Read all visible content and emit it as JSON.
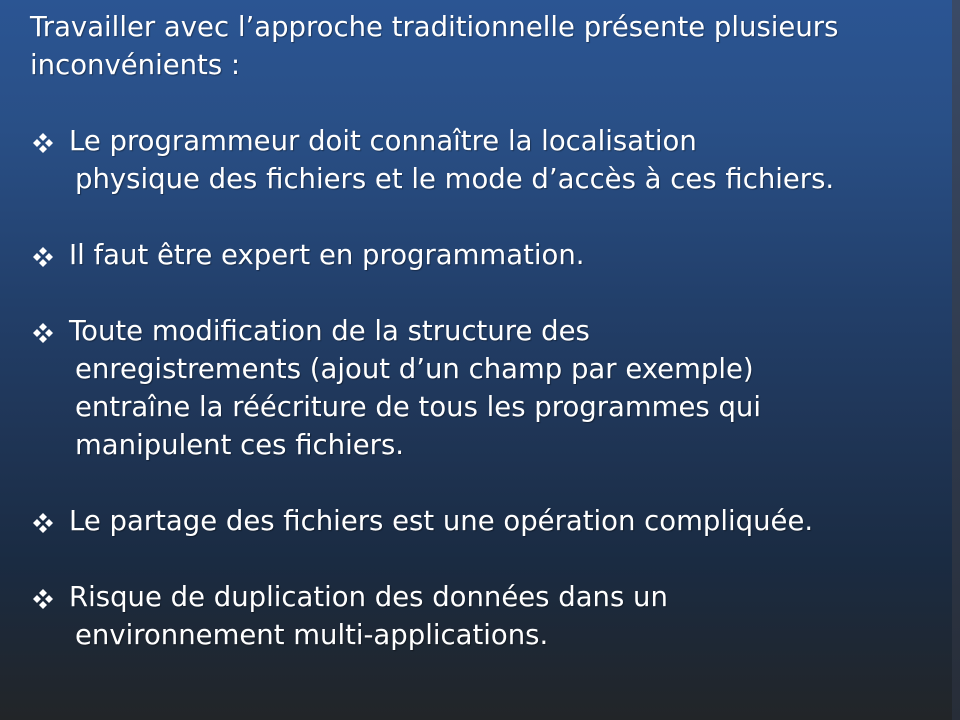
{
  "slide": {
    "intro": [
      "Travailler avec l’approche traditionnelle présente plusieurs",
      "inconvénients :"
    ],
    "bullet_icon": "four-diamond-bullet-icon",
    "bullets": [
      {
        "lines": [
          "Le programmeur doit connaître la localisation",
          "physique des fichiers et le mode d’accès à ces fichiers."
        ]
      },
      {
        "lines": [
          "Il faut être expert en programmation."
        ]
      },
      {
        "lines": [
          "Toute modification de la structure des",
          "enregistrements (ajout d’un champ par exemple)",
          "entraîne la réécriture de tous les programmes qui",
          "manipulent ces fichiers."
        ]
      },
      {
        "lines": [
          "Le partage des fichiers est une opération compliquée."
        ]
      },
      {
        "lines": [
          "Risque de duplication des données  dans un",
          "environnement multi-applications."
        ]
      }
    ]
  },
  "colors": {
    "background_top": "#2b5593",
    "background_bottom": "#222528",
    "text": "#ffffff"
  }
}
